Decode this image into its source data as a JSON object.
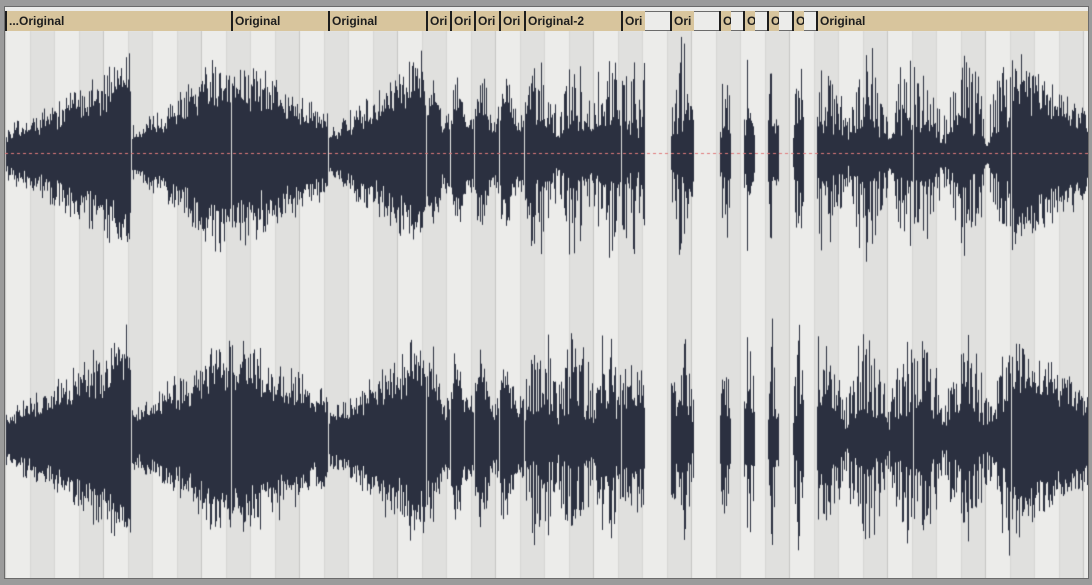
{
  "clips": [
    {
      "label": "...Original"
    },
    {
      "label": "Original"
    },
    {
      "label": "Original"
    },
    {
      "label": "Ori"
    },
    {
      "label": "Ori"
    },
    {
      "label": "Ori"
    },
    {
      "label": "Ori"
    },
    {
      "label": "Original-2"
    },
    {
      "label": "Ori"
    },
    {
      "label": "Ori"
    },
    {
      "label": "O"
    },
    {
      "label": "O"
    },
    {
      "label": "O"
    },
    {
      "label": "O"
    },
    {
      "label": "Original"
    }
  ],
  "colors": {
    "waveform": "#2b3040",
    "clip_header": "#d8c59d",
    "playline": "#e07a7a",
    "background": "#ececea",
    "stripe": "#e0e0de"
  }
}
